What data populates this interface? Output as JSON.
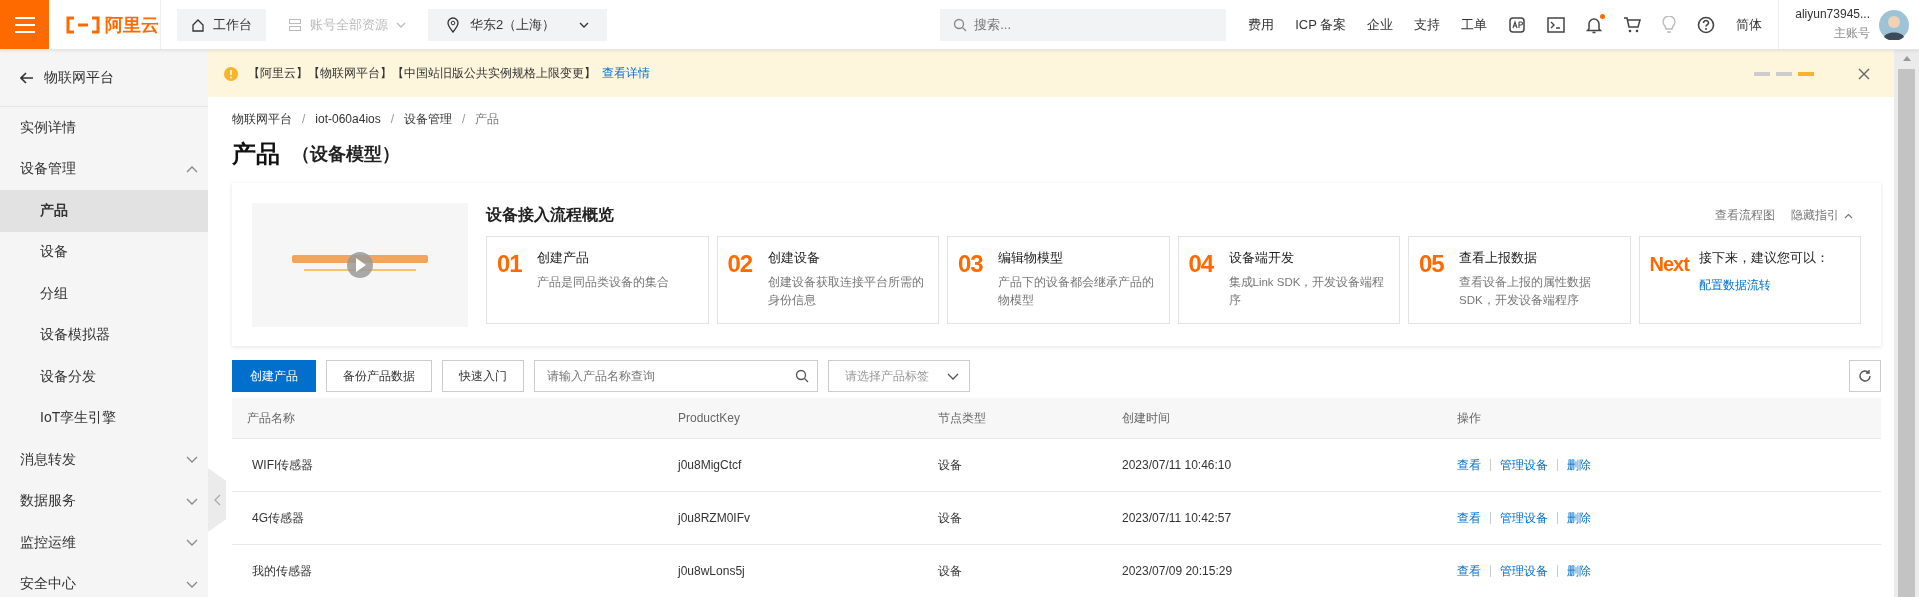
{
  "topbar": {
    "logo": "阿里云",
    "nav": [
      {
        "kind": "home",
        "label": "工作台",
        "disabled": false
      },
      {
        "kind": "resources",
        "label": "账号全部资源",
        "disabled": true
      },
      {
        "kind": "region",
        "label": "华东2（上海）",
        "disabled": false
      }
    ],
    "search": {
      "placeholder": "搜索..."
    },
    "links": [
      "费用",
      "ICP 备案",
      "企业",
      "支持",
      "工单"
    ],
    "notification": true,
    "language": "简体",
    "user": {
      "name": "aliyun73945...",
      "role": "主账号"
    }
  },
  "notice": {
    "text": "【阿里云】【物联网平台】【中国站旧版公共实例规格上限变更】",
    "link": "查看详情",
    "pages": [
      {
        "selected": false
      },
      {
        "selected": false
      },
      {
        "selected": true
      }
    ]
  },
  "sidebar": {
    "back": "物联网平台",
    "items": [
      {
        "kind": "link",
        "label": "实例详情"
      },
      {
        "kind": "group",
        "label": "设备管理",
        "expanded": true,
        "children": [
          {
            "label": "产品",
            "selected": true
          },
          {
            "label": "设备",
            "selected": false
          },
          {
            "label": "分组",
            "selected": false
          },
          {
            "label": "设备模拟器",
            "selected": false
          },
          {
            "label": "设备分发",
            "selected": false
          },
          {
            "label": "IoT孪生引擎",
            "selected": false
          }
        ]
      },
      {
        "kind": "group",
        "label": "消息转发",
        "expanded": false
      },
      {
        "kind": "group",
        "label": "数据服务",
        "expanded": false
      },
      {
        "kind": "group",
        "label": "监控运维",
        "expanded": false
      },
      {
        "kind": "group",
        "label": "安全中心",
        "expanded": false
      }
    ]
  },
  "breadcrumb": [
    {
      "label": "物联网平台"
    },
    {
      "separator": "/",
      "label": "iot-060a4ios"
    },
    {
      "separator": "/",
      "label": "设备管理"
    },
    {
      "separator": "/",
      "label": "产品"
    }
  ],
  "title": "产品",
  "subtitle": "（设备模型）",
  "guide": {
    "video": {
      "kind": "picture"
    },
    "title": "设备接入流程概览",
    "links": [
      "查看流程图",
      "隐藏指引"
    ],
    "steps": [
      {
        "kind": "step",
        "num": "01",
        "title": "创建产品",
        "desc": "产品是同品类设备的集合"
      },
      {
        "kind": "step",
        "num": "02",
        "title": "创建设备",
        "desc": "创建设备获取连接平台所需的身份信息"
      },
      {
        "kind": "step",
        "num": "03",
        "title": "编辑物模型",
        "desc": "产品下的设备都会继承产品的物模型"
      },
      {
        "kind": "step",
        "num": "04",
        "title": "设备端开发",
        "desc": "集成Link SDK，开发设备端程序"
      },
      {
        "kind": "step",
        "num": "05",
        "title": "查看上报数据",
        "desc": "查看设备上报的属性数据SDK，开发设备端程序"
      },
      {
        "kind": "next",
        "num": "Next",
        "title": "接下来，建议您可以：",
        "link": "配置数据流转"
      }
    ]
  },
  "toolbar": {
    "buttons": [
      {
        "label": "创建产品",
        "primary": true
      },
      {
        "label": "备份产品数据",
        "primary": false
      },
      {
        "label": "快速入门",
        "primary": false
      }
    ],
    "search": {
      "placeholder": "请输入产品名称查询"
    },
    "select": {
      "placeholder": "请选择产品标签"
    }
  },
  "table": {
    "columns": [
      "产品名称",
      "ProductKey",
      "节点类型",
      "创建时间",
      "操作"
    ],
    "rows": [
      {
        "name": "WIFI传感器",
        "key": "j0u8MigCtcf",
        "type": "设备",
        "time": "2023/07/11 10:46:10",
        "actions": [
          "查看",
          "管理设备",
          "删除"
        ]
      },
      {
        "name": "4G传感器",
        "key": "j0u8RZM0IFv",
        "type": "设备",
        "time": "2023/07/11 10:42:57",
        "actions": [
          "查看",
          "管理设备",
          "删除"
        ]
      },
      {
        "name": "我的传感器",
        "key": "j0u8wLons5j",
        "type": "设备",
        "time": "2023/07/09 20:15:29",
        "actions": [
          "查看",
          "管理设备",
          "删除"
        ]
      }
    ]
  }
}
